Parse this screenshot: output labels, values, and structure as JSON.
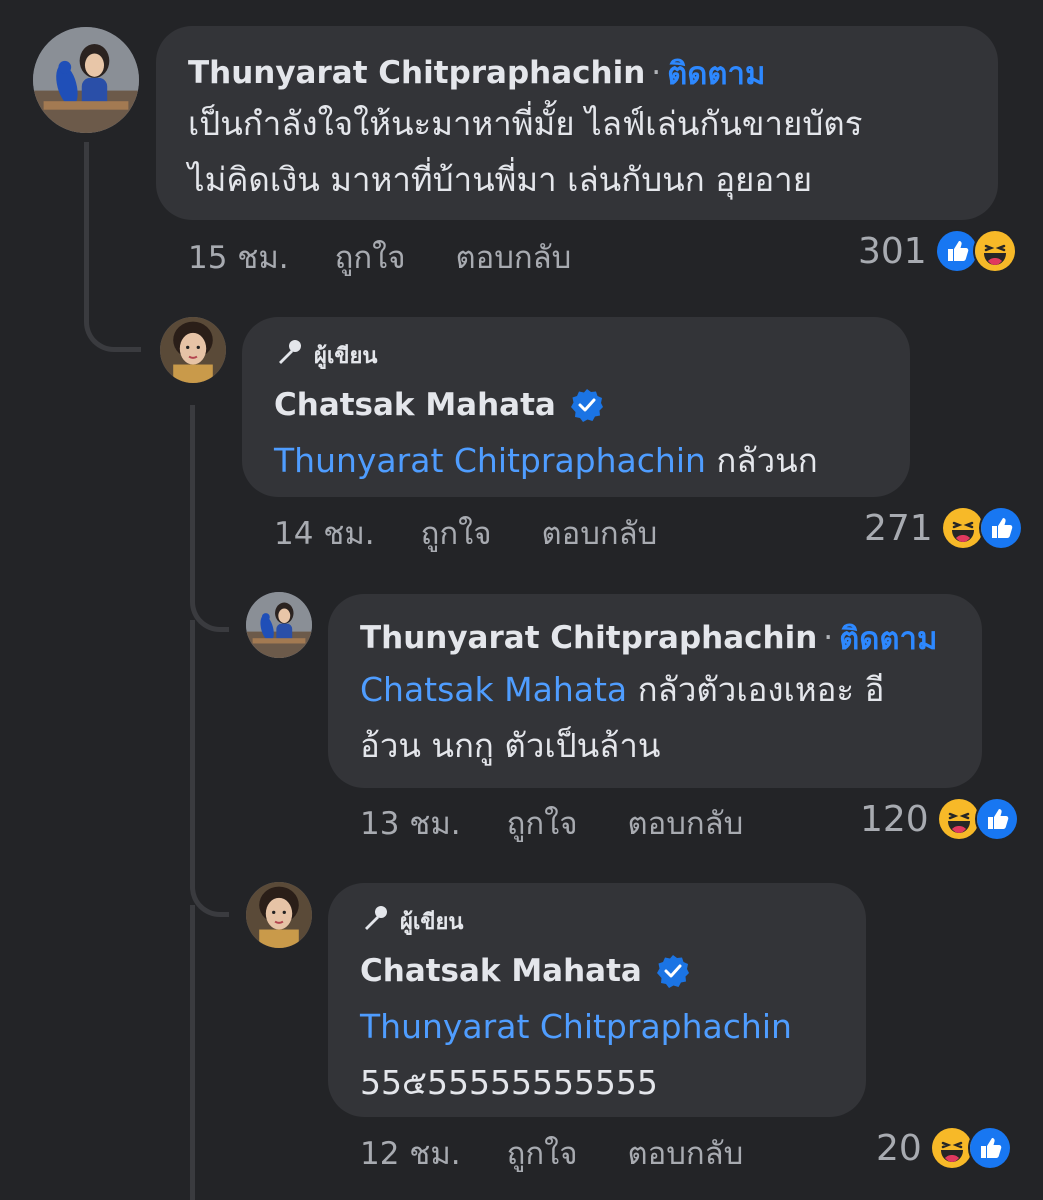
{
  "comments": [
    {
      "author": "Thunyarat Chitpraphachin",
      "follow_label": "ติดตาม",
      "line1": "เป็นกำลังใจให้นะมาหาพี่มั้ย ไลฟ์เล่นกันขายบัตร",
      "line2": "ไม่คิดเงิน มาหาที่บ้านพี่มา เล่นกับนก อุยอาย",
      "time": "15 ชม.",
      "like_label": "ถูกใจ",
      "reply_label": "ตอบกลับ",
      "reaction_count": "301",
      "reactions": [
        "like-reaction-icon",
        "haha-reaction-icon"
      ]
    },
    {
      "author_badge": "ผู้เขียน",
      "author": "Chatsak Mahata",
      "mention": "Thunyarat Chitpraphachin",
      "text": "กลัวนก",
      "time": "14 ชม.",
      "like_label": "ถูกใจ",
      "reply_label": "ตอบกลับ",
      "reaction_count": "271",
      "reactions": [
        "haha-reaction-icon",
        "like-reaction-icon"
      ]
    },
    {
      "author": "Thunyarat Chitpraphachin",
      "follow_label": "ติดตาม",
      "mention": "Chatsak Mahata",
      "text_line1": "กลัวตัวเองเหอะ อี",
      "text_line2": "อ้วน นกกู ตัวเป็นล้าน",
      "time": "13 ชม.",
      "like_label": "ถูกใจ",
      "reply_label": "ตอบกลับ",
      "reaction_count": "120",
      "reactions": [
        "haha-reaction-icon",
        "like-reaction-icon"
      ]
    },
    {
      "author_badge": "ผู้เขียน",
      "author": "Chatsak Mahata",
      "mention": "Thunyarat Chitpraphachin",
      "text": "55๕55555555555",
      "time": "12 ชม.",
      "like_label": "ถูกใจ",
      "reply_label": "ตอบกลับ",
      "reaction_count": "20",
      "reactions": [
        "haha-reaction-icon",
        "like-reaction-icon"
      ]
    }
  ],
  "colors": {
    "background": "#232427",
    "bubble": "#333438",
    "follow": "#2d88ff",
    "mention": "#4f9dff",
    "muted": "#a8abb1",
    "like_blue": "#1877f2",
    "haha_yellow": "#f7b928"
  }
}
